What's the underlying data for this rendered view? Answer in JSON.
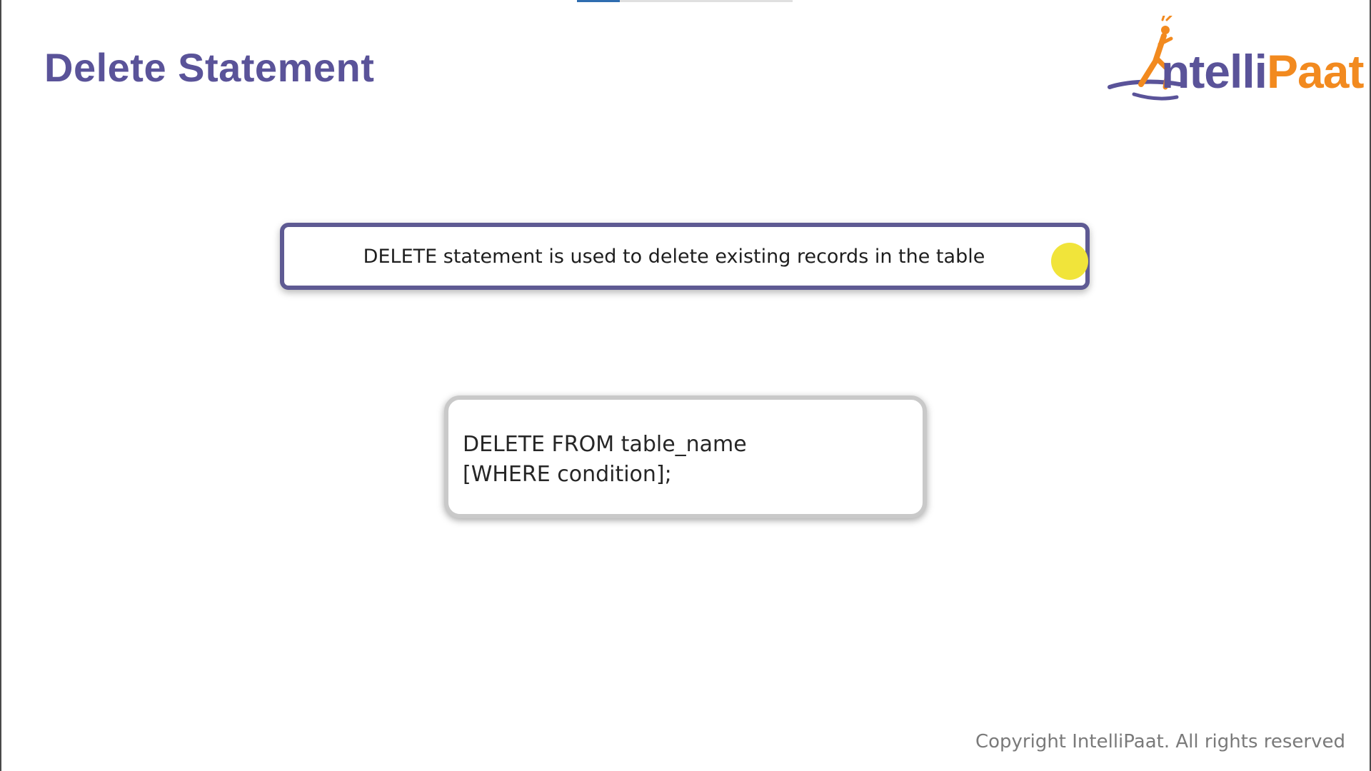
{
  "slide": {
    "title": "Delete Statement",
    "definition": "DELETE statement is used to delete existing records in the table",
    "syntax": {
      "line1": "DELETE FROM table_name",
      "line2": "[WHERE condition];"
    },
    "copyright": "Copyright IntelliPaat. All rights reserved"
  },
  "logo": {
    "text_intelli": "ntelli",
    "text_paat": "Paat",
    "primary_color": "#5a5399",
    "accent_color": "#f28a1f"
  },
  "video_progress": {
    "fraction": 0.2
  },
  "colors": {
    "title": "#5a5399",
    "definition_border": "#5e5a93",
    "pointer": "#f1e43a"
  }
}
